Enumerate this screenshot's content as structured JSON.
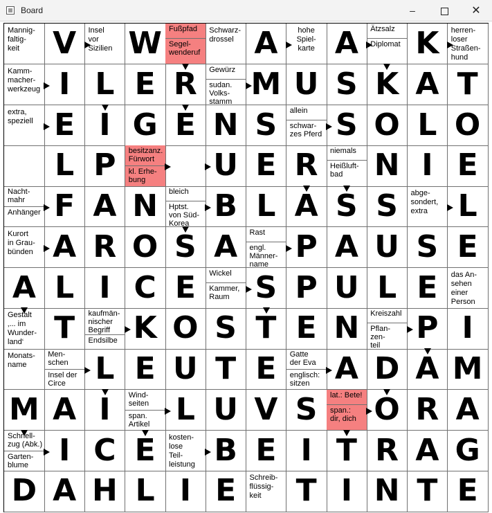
{
  "window": {
    "title": "Board",
    "controls": {
      "minimize": "–",
      "close": "✕"
    }
  },
  "grid": {
    "cols": 12,
    "rows": 12,
    "cells": [
      [
        {
          "t": "c",
          "text": "Mannig-\nfaltig-\nkeit"
        },
        {
          "t": "l",
          "ch": "V"
        },
        {
          "t": "c",
          "text": "Insel\nvor\nSizilien"
        },
        {
          "t": "l",
          "ch": "W"
        },
        {
          "t": "s",
          "top": "Fußpfad",
          "bot": "Segel-\nwenderuf",
          "red": true
        },
        {
          "t": "c",
          "text": "Schwarz-\ndrossel"
        },
        {
          "t": "l",
          "ch": "A"
        },
        {
          "t": "c",
          "text": "hohe\nSpiel-\nkarte",
          "center": true
        },
        {
          "t": "l",
          "ch": "A"
        },
        {
          "t": "s",
          "top": "Ätzsalz",
          "bot": "Diplomat"
        },
        {
          "t": "l",
          "ch": "K"
        },
        {
          "t": "c",
          "text": "herren-\nloser\nStraßen-\nhund"
        }
      ],
      [
        {
          "t": "c",
          "text": "Kamm-\nmacher-\nwerkzeug"
        },
        {
          "t": "l",
          "ch": "I"
        },
        {
          "t": "l",
          "ch": "L"
        },
        {
          "t": "l",
          "ch": "E"
        },
        {
          "t": "l",
          "ch": "R"
        },
        {
          "t": "s",
          "top": "Gewürz",
          "bot": "sudan.\nVolks-\nstamm"
        },
        {
          "t": "l",
          "ch": "M"
        },
        {
          "t": "l",
          "ch": "U"
        },
        {
          "t": "l",
          "ch": "S"
        },
        {
          "t": "l",
          "ch": "K"
        },
        {
          "t": "l",
          "ch": "A"
        },
        {
          "t": "l",
          "ch": "T"
        }
      ],
      [
        {
          "t": "c",
          "text": "extra,\nspeziell"
        },
        {
          "t": "l",
          "ch": "E"
        },
        {
          "t": "l",
          "ch": "I"
        },
        {
          "t": "l",
          "ch": "G"
        },
        {
          "t": "l",
          "ch": "E"
        },
        {
          "t": "l",
          "ch": "N"
        },
        {
          "t": "l",
          "ch": "S"
        },
        {
          "t": "s",
          "top": "allein",
          "bot": "schwar-\nzes Pferd"
        },
        {
          "t": "l",
          "ch": "S"
        },
        {
          "t": "l",
          "ch": "O"
        },
        {
          "t": "l",
          "ch": "L"
        },
        {
          "t": "l",
          "ch": "O"
        }
      ],
      [
        {
          "t": "l",
          "ch": ""
        },
        {
          "t": "l",
          "ch": "L"
        },
        {
          "t": "l",
          "ch": "P"
        },
        {
          "t": "s",
          "top": "besitzanz.\nFürwort",
          "bot": "kl. Erhe-\nbung",
          "red": true
        },
        {
          "t": "l",
          "ch": ""
        },
        {
          "t": "l",
          "ch": "U"
        },
        {
          "t": "l",
          "ch": "E"
        },
        {
          "t": "l",
          "ch": "R"
        },
        {
          "t": "s",
          "top": "niemals",
          "bot": "Heißluft-\nbad"
        },
        {
          "t": "l",
          "ch": "N"
        },
        {
          "t": "l",
          "ch": "I"
        },
        {
          "t": "l",
          "ch": "E"
        }
      ],
      [
        {
          "t": "s",
          "top": "Nacht-\nmahr",
          "bot": "Anhänger"
        },
        {
          "t": "l",
          "ch": "F"
        },
        {
          "t": "l",
          "ch": "A"
        },
        {
          "t": "l",
          "ch": "N"
        },
        {
          "t": "s",
          "top": "bleich",
          "bot": "Hptst.\nvon Süd-\nKorea"
        },
        {
          "t": "l",
          "ch": "B"
        },
        {
          "t": "l",
          "ch": "L"
        },
        {
          "t": "l",
          "ch": "A"
        },
        {
          "t": "l",
          "ch": "S"
        },
        {
          "t": "l",
          "ch": "S"
        },
        {
          "t": "c",
          "text": "abge-\nsondert,\nextra"
        },
        {
          "t": "l",
          "ch": "L"
        }
      ],
      [
        {
          "t": "c",
          "text": "Kurort\nin Grau-\nbünden"
        },
        {
          "t": "l",
          "ch": "A"
        },
        {
          "t": "l",
          "ch": "R"
        },
        {
          "t": "l",
          "ch": "O"
        },
        {
          "t": "l",
          "ch": "S"
        },
        {
          "t": "l",
          "ch": "A"
        },
        {
          "t": "s",
          "top": "Rast",
          "bot": "engl.\nMänner-\nname"
        },
        {
          "t": "l",
          "ch": "P"
        },
        {
          "t": "l",
          "ch": "A"
        },
        {
          "t": "l",
          "ch": "U"
        },
        {
          "t": "l",
          "ch": "S"
        },
        {
          "t": "l",
          "ch": "E"
        }
      ],
      [
        {
          "t": "l",
          "ch": "A"
        },
        {
          "t": "l",
          "ch": "L"
        },
        {
          "t": "l",
          "ch": "I"
        },
        {
          "t": "l",
          "ch": "C"
        },
        {
          "t": "l",
          "ch": "E"
        },
        {
          "t": "s",
          "top": "Wickel",
          "bot": "Kammer,\nRaum"
        },
        {
          "t": "l",
          "ch": "S"
        },
        {
          "t": "l",
          "ch": "P"
        },
        {
          "t": "l",
          "ch": "U"
        },
        {
          "t": "l",
          "ch": "L"
        },
        {
          "t": "l",
          "ch": "E"
        },
        {
          "t": "c",
          "text": "das An-\nsehen\neiner\nPerson"
        }
      ],
      [
        {
          "t": "c",
          "text": "Gestalt\n‚... im\nWunder-\nland‘"
        },
        {
          "t": "l",
          "ch": "T"
        },
        {
          "t": "s",
          "top": "kaufmän-\nnischer\nBegriff",
          "bot": "Endsilbe"
        },
        {
          "t": "l",
          "ch": "K"
        },
        {
          "t": "l",
          "ch": "O"
        },
        {
          "t": "l",
          "ch": "S"
        },
        {
          "t": "l",
          "ch": "T"
        },
        {
          "t": "l",
          "ch": "E"
        },
        {
          "t": "l",
          "ch": "N"
        },
        {
          "t": "s",
          "top": "Kreiszahl",
          "bot": "Pflan-\nzen-\nteil"
        },
        {
          "t": "l",
          "ch": "P"
        },
        {
          "t": "l",
          "ch": "I"
        }
      ],
      [
        {
          "t": "c",
          "text": "Monats-\nname"
        },
        {
          "t": "s",
          "top": "Men-\nschen",
          "bot": "Insel der\nCirce"
        },
        {
          "t": "l",
          "ch": "L"
        },
        {
          "t": "l",
          "ch": "E"
        },
        {
          "t": "l",
          "ch": "U"
        },
        {
          "t": "l",
          "ch": "T"
        },
        {
          "t": "l",
          "ch": "E"
        },
        {
          "t": "s",
          "top": "Gatte\nder Eva",
          "bot": "englisch:\nsitzen"
        },
        {
          "t": "l",
          "ch": "A"
        },
        {
          "t": "l",
          "ch": "D"
        },
        {
          "t": "l",
          "ch": "A"
        },
        {
          "t": "l",
          "ch": "M"
        }
      ],
      [
        {
          "t": "l",
          "ch": "M"
        },
        {
          "t": "l",
          "ch": "A"
        },
        {
          "t": "l",
          "ch": "I"
        },
        {
          "t": "s",
          "top": "Wind-\nseiten",
          "bot": "span.\nArtikel"
        },
        {
          "t": "l",
          "ch": "L"
        },
        {
          "t": "l",
          "ch": "U"
        },
        {
          "t": "l",
          "ch": "V"
        },
        {
          "t": "l",
          "ch": "S"
        },
        {
          "t": "s",
          "top": "lat.: Bete!",
          "bot": "span.:\ndir, dich",
          "red": true
        },
        {
          "t": "l",
          "ch": "O"
        },
        {
          "t": "l",
          "ch": "R"
        },
        {
          "t": "l",
          "ch": "A"
        }
      ],
      [
        {
          "t": "s",
          "top": "Schnell-\nzug (Abk.)",
          "bot": "Garten-\nblume"
        },
        {
          "t": "l",
          "ch": "I"
        },
        {
          "t": "l",
          "ch": "C"
        },
        {
          "t": "l",
          "ch": "E"
        },
        {
          "t": "c",
          "text": "kosten-\nlose\nTeil-\nleistung"
        },
        {
          "t": "l",
          "ch": "B"
        },
        {
          "t": "l",
          "ch": "E"
        },
        {
          "t": "l",
          "ch": "I"
        },
        {
          "t": "l",
          "ch": "T"
        },
        {
          "t": "l",
          "ch": "R"
        },
        {
          "t": "l",
          "ch": "A"
        },
        {
          "t": "l",
          "ch": "G"
        }
      ],
      [
        {
          "t": "l",
          "ch": "D"
        },
        {
          "t": "l",
          "ch": "A"
        },
        {
          "t": "l",
          "ch": "H"
        },
        {
          "t": "l",
          "ch": "L"
        },
        {
          "t": "l",
          "ch": "I"
        },
        {
          "t": "l",
          "ch": "E"
        },
        {
          "t": "c",
          "text": "Schreib-\nflüssig-\nkeit"
        },
        {
          "t": "l",
          "ch": "T"
        },
        {
          "t": "l",
          "ch": "I"
        },
        {
          "t": "l",
          "ch": "N"
        },
        {
          "t": "l",
          "ch": "T"
        },
        {
          "t": "l",
          "ch": "E"
        }
      ]
    ]
  },
  "colors": {
    "highlight": "#f58080",
    "grid_line": "#707070",
    "text": "#000000"
  }
}
